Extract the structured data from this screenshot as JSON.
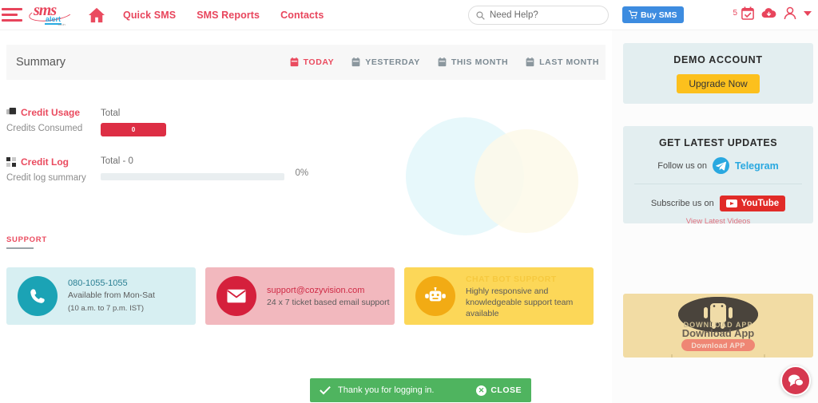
{
  "header": {
    "menu_icon": "hamburger-icon",
    "logo_main": "sms",
    "logo_sub": "alert",
    "logo_tld": ".co.in",
    "home_icon": "home-icon",
    "nav": [
      {
        "label": "Quick SMS"
      },
      {
        "label": "SMS Reports"
      },
      {
        "label": "Contacts"
      }
    ],
    "search": {
      "placeholder": "Need Help?",
      "value": "",
      "icon": "search-icon"
    },
    "buy_sms_label": "Buy SMS",
    "buy_sms_icon": "cart-icon",
    "notification_count": "5",
    "icons": [
      "calendar-check-icon",
      "cloud-download-icon",
      "user-icon",
      "chevron-down-icon"
    ]
  },
  "summary": {
    "title": "Summary",
    "periods": [
      {
        "label": "TODAY",
        "active": true
      },
      {
        "label": "YESTERDAY",
        "active": false
      },
      {
        "label": "THIS MONTH",
        "active": false
      },
      {
        "label": "LAST MONTH",
        "active": false
      }
    ],
    "credit_usage": {
      "title": "Credit Usage",
      "subtitle": "Credits Consumed",
      "total_label": "Total",
      "bar_value": "0",
      "icon": "credit-usage-icon"
    },
    "credit_log": {
      "title": "Credit Log",
      "subtitle": "Credit log summary",
      "total_label": "Total - 0",
      "percent": "0%",
      "progress": 0,
      "icon": "credit-log-icon"
    }
  },
  "support": {
    "heading": "SUPPORT",
    "cards": [
      {
        "icon": "phone-icon",
        "line1": "080-1055-1055",
        "line2": "Available from Mon-Sat",
        "line3": "(10 a.m. to 7 p.m. IST)"
      },
      {
        "icon": "envelope-icon",
        "line1": "support@cozyvision.com",
        "line2": "24 x 7 ticket based email support",
        "line3": ""
      },
      {
        "icon": "robot-icon",
        "line1": "CHAT BOT SUPPORT",
        "line2": "Highly responsive and knowledgeable support team available",
        "line3": ""
      }
    ]
  },
  "sidebar": {
    "demo": {
      "title": "DEMO ACCOUNT",
      "button_label": "Upgrade Now"
    },
    "updates": {
      "title": "GET LATEST UPDATES",
      "follow_label": "Follow us on",
      "telegram_label": "Telegram",
      "telegram_icon": "telegram-icon",
      "subscribe_label": "Subscribe us on",
      "youtube_label": "YouTube",
      "youtube_icon": "youtube-icon",
      "view_videos_label": "View Latest Videos"
    },
    "app_banner": {
      "ghost_text": "DOWNLOAD APP",
      "title": "Download App",
      "button_label": "Download APP",
      "icon": "android-robot-icon"
    },
    "chat_fab_icon": "chat-bubbles-icon"
  },
  "toast": {
    "icon": "check-icon",
    "message": "Thank you for logging in.",
    "close_label": "CLOSE",
    "close_icon": "close-circle-icon"
  },
  "colors": {
    "brand_red": "#ea4b5f",
    "accent_blue": "#3d8ce0",
    "toast_green": "#4fb45f",
    "upgrade_yellow": "#fcc01d",
    "telegram_blue": "#29a8e0",
    "youtube_red": "#e12b28"
  }
}
